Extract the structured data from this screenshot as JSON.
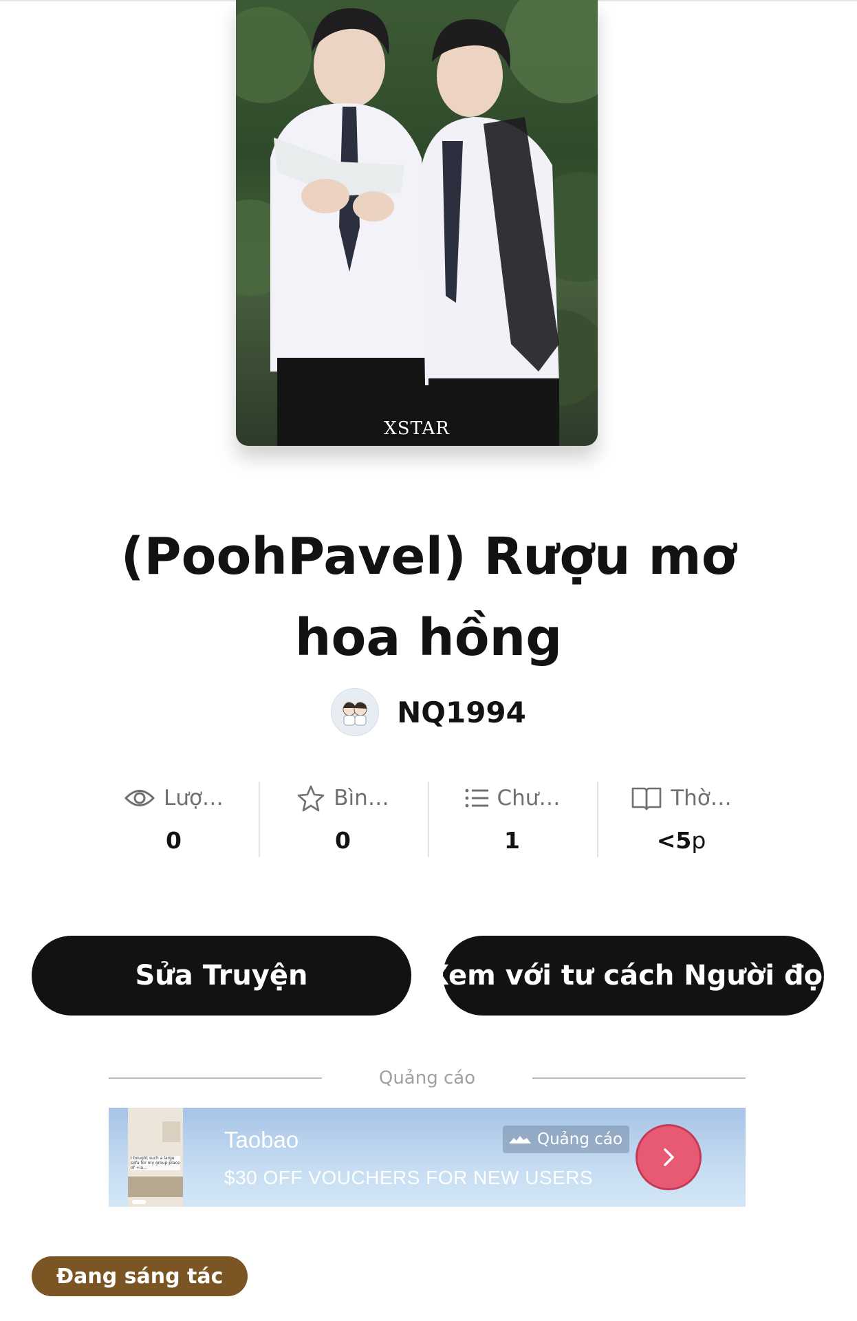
{
  "cover": {
    "watermark": "XSTAR"
  },
  "story": {
    "title": "(PoohPavel) Rượu mơ hoa hồng"
  },
  "author": {
    "name": "NQ1994"
  },
  "stats": [
    {
      "icon": "eye-icon",
      "label": "Lượ…",
      "value": "0"
    },
    {
      "icon": "star-icon",
      "label": "Bìn…",
      "value": "0"
    },
    {
      "icon": "list-icon",
      "label": "Chư…",
      "value": "1"
    },
    {
      "icon": "book-icon",
      "label": "Thờ…",
      "value": "<5",
      "unit": "p"
    }
  ],
  "actions": {
    "edit_label": "Sửa Truyện",
    "view_as_reader_label": "Xem với tư cách Người đọc"
  },
  "ad": {
    "section_label": "Quảng cáo",
    "brand": "Taobao",
    "tagline": "$30 OFF VOUCHERS FOR NEW USERS",
    "badge": "Quảng cáo",
    "thumb_text": "I bought such a large sofa for my group place of +ia..."
  },
  "status": {
    "label": "Đang sáng tác"
  },
  "colors": {
    "primary_button": "#121212",
    "status_pill": "#7b5524",
    "ad_cta": "#e85a73"
  }
}
